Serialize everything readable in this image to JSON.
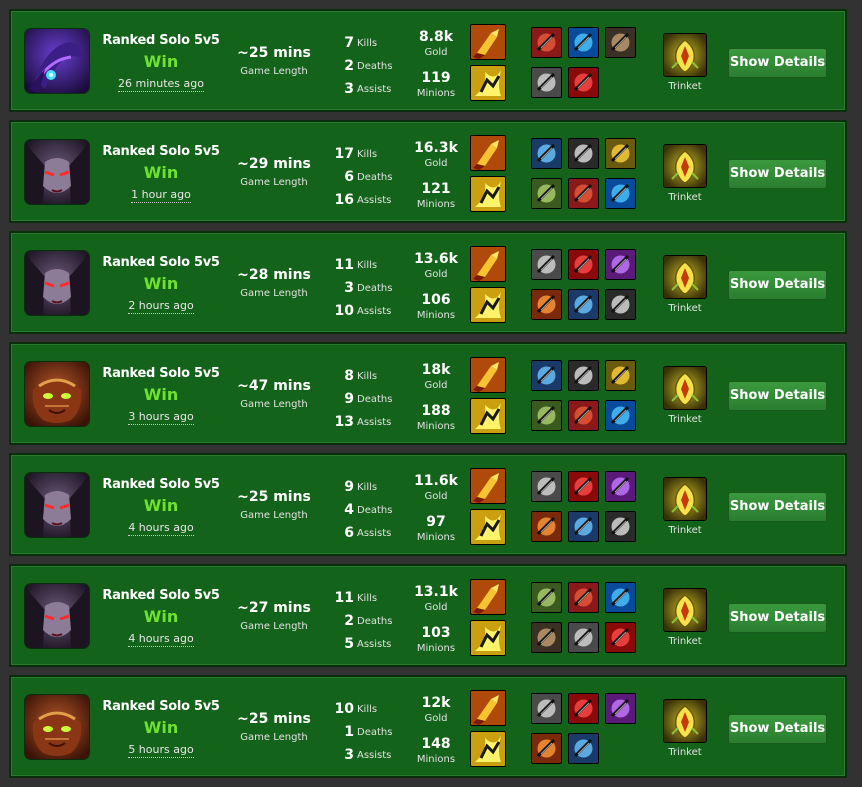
{
  "matches": [
    {
      "queue": "Ranked Solo 5v5",
      "result": "Win",
      "time_ago": "26 minutes ago",
      "length": "~25 mins",
      "length_label": "Game Length",
      "kills": "7",
      "kills_label": "Kills",
      "deaths": "2",
      "deaths_label": "Deaths",
      "assists": "3",
      "assists_label": "Assists",
      "gold": "8.8k",
      "gold_label": "Gold",
      "minions": "119",
      "minions_label": "Minions",
      "trinket_label": "Trinket",
      "details_label": "Show Details",
      "champion_icon": "purple-void-champion-icon",
      "item_count": 5
    },
    {
      "queue": "Ranked Solo 5v5",
      "result": "Win",
      "time_ago": "1 hour ago",
      "length": "~29 mins",
      "length_label": "Game Length",
      "kills": "17",
      "kills_label": "Kills",
      "deaths": "6",
      "deaths_label": "Deaths",
      "assists": "16",
      "assists_label": "Assists",
      "gold": "16.3k",
      "gold_label": "Gold",
      "minions": "121",
      "minions_label": "Minions",
      "trinket_label": "Trinket",
      "details_label": "Show Details",
      "champion_icon": "dark-assassin-champion-icon",
      "item_count": 6
    },
    {
      "queue": "Ranked Solo 5v5",
      "result": "Win",
      "time_ago": "2 hours ago",
      "length": "~28 mins",
      "length_label": "Game Length",
      "kills": "11",
      "kills_label": "Kills",
      "deaths": "3",
      "deaths_label": "Deaths",
      "assists": "10",
      "assists_label": "Assists",
      "gold": "13.6k",
      "gold_label": "Gold",
      "minions": "106",
      "minions_label": "Minions",
      "trinket_label": "Trinket",
      "details_label": "Show Details",
      "champion_icon": "dark-assassin-champion-icon",
      "item_count": 6
    },
    {
      "queue": "Ranked Solo 5v5",
      "result": "Win",
      "time_ago": "3 hours ago",
      "length": "~47 mins",
      "length_label": "Game Length",
      "kills": "8",
      "kills_label": "Kills",
      "deaths": "9",
      "deaths_label": "Deaths",
      "assists": "13",
      "assists_label": "Assists",
      "gold": "18k",
      "gold_label": "Gold",
      "minions": "188",
      "minions_label": "Minions",
      "trinket_label": "Trinket",
      "details_label": "Show Details",
      "champion_icon": "monkey-king-champion-icon",
      "item_count": 6
    },
    {
      "queue": "Ranked Solo 5v5",
      "result": "Win",
      "time_ago": "4 hours ago",
      "length": "~25 mins",
      "length_label": "Game Length",
      "kills": "9",
      "kills_label": "Kills",
      "deaths": "4",
      "deaths_label": "Deaths",
      "assists": "6",
      "assists_label": "Assists",
      "gold": "11.6k",
      "gold_label": "Gold",
      "minions": "97",
      "minions_label": "Minions",
      "trinket_label": "Trinket",
      "details_label": "Show Details",
      "champion_icon": "dark-assassin-champion-icon",
      "item_count": 6
    },
    {
      "queue": "Ranked Solo 5v5",
      "result": "Win",
      "time_ago": "4 hours ago",
      "length": "~27 mins",
      "length_label": "Game Length",
      "kills": "11",
      "kills_label": "Kills",
      "deaths": "2",
      "deaths_label": "Deaths",
      "assists": "5",
      "assists_label": "Assists",
      "gold": "13.1k",
      "gold_label": "Gold",
      "minions": "103",
      "minions_label": "Minions",
      "trinket_label": "Trinket",
      "details_label": "Show Details",
      "champion_icon": "dark-assassin-champion-icon",
      "item_count": 6
    },
    {
      "queue": "Ranked Solo 5v5",
      "result": "Win",
      "time_ago": "5 hours ago",
      "length": "~25 mins",
      "length_label": "Game Length",
      "kills": "10",
      "kills_label": "Kills",
      "deaths": "1",
      "deaths_label": "Deaths",
      "assists": "3",
      "assists_label": "Assists",
      "gold": "12k",
      "gold_label": "Gold",
      "minions": "148",
      "minions_label": "Minions",
      "trinket_label": "Trinket",
      "details_label": "Show Details",
      "champion_icon": "monkey-king-champion-icon",
      "item_count": 5
    }
  ],
  "colors": {
    "row_bg": "#14631a",
    "win": "#6fe12f",
    "page_bg": "#323232",
    "button": "#2f8834"
  },
  "summoner_spells": [
    "ignite-icon",
    "flash-icon"
  ],
  "trinket_icon": "warding-totem-icon"
}
